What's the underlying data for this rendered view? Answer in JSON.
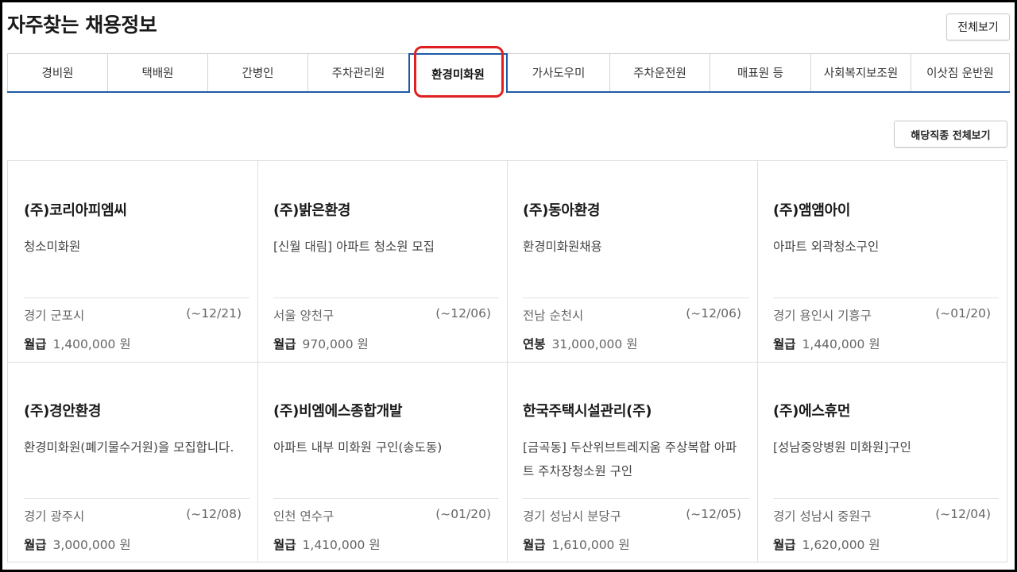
{
  "page": {
    "title": "자주찾는 채용정보",
    "view_all_label": "전체보기"
  },
  "tabs": [
    {
      "label": "경비원",
      "active": false
    },
    {
      "label": "택배원",
      "active": false
    },
    {
      "label": "간병인",
      "active": false
    },
    {
      "label": "주차관리원",
      "active": false
    },
    {
      "label": "환경미화원",
      "active": true
    },
    {
      "label": "가사도우미",
      "active": false
    },
    {
      "label": "주차운전원",
      "active": false
    },
    {
      "label": "매표원 등",
      "active": false
    },
    {
      "label": "사회복지보조원",
      "active": false
    },
    {
      "label": "이삿짐 운반원",
      "active": false
    }
  ],
  "category_view_all_label": "해당직종 전체보기",
  "colors": {
    "accent": "#1f5aa6",
    "highlight": "#e02020"
  },
  "jobs": [
    {
      "company": "(주)코리아피엠씨",
      "title": "청소미화원",
      "location": "경기 군포시",
      "deadline": "(~12/21)",
      "pay_type": "월급",
      "pay": "1,400,000 원"
    },
    {
      "company": "(주)밝은환경",
      "title": "[신월 대림] 아파트 청소원 모집",
      "location": "서울 양천구",
      "deadline": "(~12/06)",
      "pay_type": "월급",
      "pay": "970,000 원"
    },
    {
      "company": "(주)동아환경",
      "title": "환경미화원채용",
      "location": "전남 순천시",
      "deadline": "(~12/06)",
      "pay_type": "연봉",
      "pay": "31,000,000 원"
    },
    {
      "company": "(주)앰앰아이",
      "title": "아파트 외곽청소구인",
      "location": "경기 용인시 기흥구",
      "deadline": "(~01/20)",
      "pay_type": "월급",
      "pay": "1,440,000 원"
    },
    {
      "company": "(주)경안환경",
      "title": "환경미화원(폐기물수거원)을 모집합니다.",
      "location": "경기 광주시",
      "deadline": "(~12/08)",
      "pay_type": "월급",
      "pay": "3,000,000 원"
    },
    {
      "company": "(주)비엠에스종합개발",
      "title": "아파트 내부 미화원 구인(송도동)",
      "location": "인천 연수구",
      "deadline": "(~01/20)",
      "pay_type": "월급",
      "pay": "1,410,000 원"
    },
    {
      "company": "한국주택시설관리(주)",
      "title": "[금곡동] 두산위브트레지움 주상복합 아파트 주차장청소원 구인",
      "location": "경기 성남시 분당구",
      "deadline": "(~12/05)",
      "pay_type": "월급",
      "pay": "1,610,000 원"
    },
    {
      "company": "(주)에스휴먼",
      "title": "[성남중앙병원 미화원]구인",
      "location": "경기 성남시 중원구",
      "deadline": "(~12/04)",
      "pay_type": "월급",
      "pay": "1,620,000 원"
    }
  ]
}
